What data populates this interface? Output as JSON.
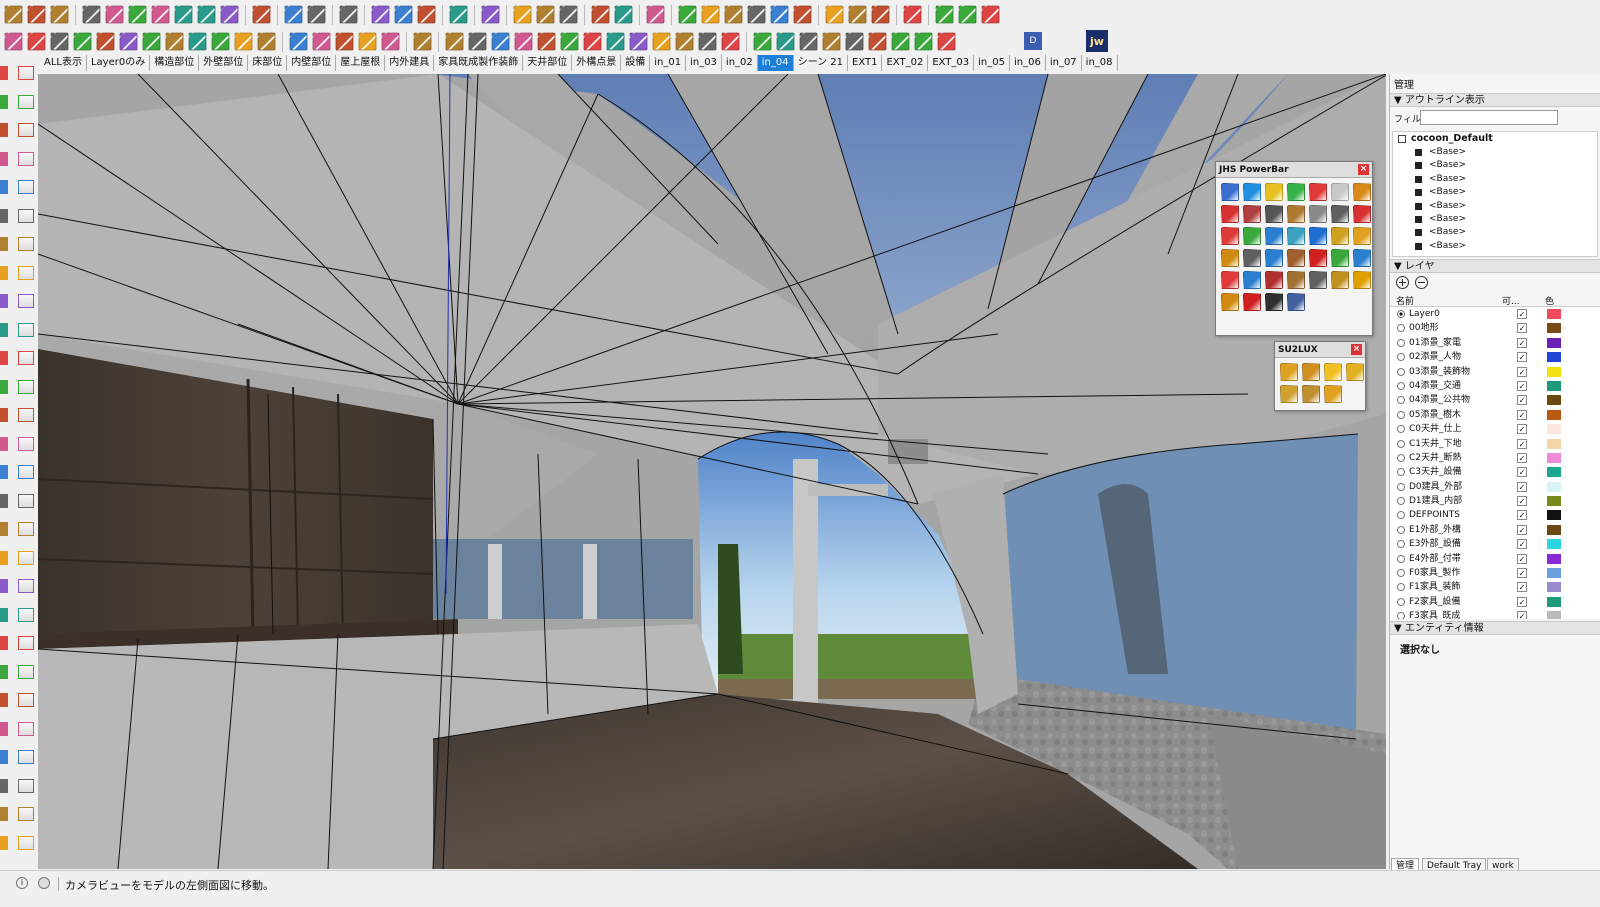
{
  "toolbar": {
    "row1_icons": [
      "box-icon",
      "cube-icon",
      "component-icon",
      "sep",
      "paint-bucket-icon",
      "push-pull-icon",
      "rotate-icon",
      "scale-icon",
      "offset-icon",
      "follow-me-icon",
      "intersect-icon",
      "sep",
      "section-icon",
      "sep",
      "dimension-icon",
      "clock-icon",
      "sep",
      "zoom-window-icon",
      "sep",
      "shield-icon",
      "sandbox-icon",
      "flip-icon",
      "sep",
      "purple-cone-icon",
      "sep",
      "leaf-icon",
      "sep",
      "plant-a-icon",
      "plant-b-icon",
      "plant-c-icon",
      "sep",
      "book-icon",
      "book-red-icon",
      "sep",
      "stairs-icon",
      "sep",
      "sphere-icon",
      "sphere2-icon",
      "sphere3-icon",
      "sphere4-icon",
      "sphere5-icon",
      "list-icon",
      "sep",
      "north-icon",
      "knife-icon",
      "target-icon",
      "sep",
      "record-icon",
      "sep",
      "orbit-icon",
      "render-a-icon",
      "render-b-icon"
    ],
    "row2_icons": [
      "wave-icon",
      "freehand-icon",
      "zigzag-icon",
      "bracket-icon",
      "arc-icon",
      "rect-icon",
      "circle-icon",
      "arc2-icon",
      "spiral-icon",
      "curve-icon",
      "curve2-icon",
      "curve3-icon",
      "sep",
      "tool-a-icon",
      "tool-b-icon",
      "wrench-icon",
      "ring-icon",
      "shape-icon",
      "sep",
      "gear-shade-icon",
      "sep",
      "edit-a-icon",
      "edit-b-icon",
      "edit-c-icon",
      "edit-d-icon",
      "edit-e-icon",
      "edit-f-icon",
      "edit-g-icon",
      "edit-h-icon",
      "edit-i-icon",
      "edit-j-icon",
      "edit-k-icon",
      "edit-l-icon",
      "help-icon",
      "sep",
      "pin-icon",
      "curve-tool-icon",
      "curve-tool2-icon",
      "target2-icon",
      "target3-icon",
      "curve-tool3-icon",
      "curve-tool4-icon",
      "play-icon",
      "step-icon"
    ],
    "d_button": "D",
    "jw_button": "jw"
  },
  "scene_tabs": {
    "items": [
      "ALL表示",
      "Layer0のみ",
      "構造部位",
      "外壁部位",
      "床部位",
      "内壁部位",
      "屋上屋根",
      "内外建具",
      "家具既成製作装飾",
      "天井部位",
      "外構点景",
      "設備",
      "in_01",
      "in_03",
      "in_02",
      "in_04",
      "シーン 21",
      "EXT1",
      "EXT_02",
      "EXT_03",
      "in_05",
      "in_06",
      "in_07",
      "in_08"
    ],
    "active_index": 15
  },
  "jhs_powerbar": {
    "title": "JHS PowerBar",
    "close": "×",
    "icon_colors": [
      "#3a6fcf",
      "#1f8fe0",
      "#e5c020",
      "#36b24a",
      "#e03a3a",
      "#c8c8c8",
      "#d98a1a",
      "#d63030",
      "#b04040",
      "#555555",
      "#b07830",
      "#8a8a8a",
      "#606060",
      "#d63030",
      "#e03a3a",
      "#3aa83a",
      "#2a7fd0",
      "#3aa0c0",
      "#1e6fd0",
      "#d0a020",
      "#e0a020",
      "#d08a10",
      "#606060",
      "#2a7fd0",
      "#a06030",
      "#d02020",
      "#3aa83a",
      "#2a7fd0",
      "#e03a3a",
      "#2a7fd0",
      "#b03030",
      "#a07030",
      "#606060",
      "#c09020",
      "#e0a000",
      "#d08a10",
      "#d02020",
      "#303030",
      "#4060a0"
    ]
  },
  "su2lux": {
    "title": "SU2LUX",
    "close": "×",
    "icon_colors": [
      "#e0a020",
      "#d09020",
      "#f0c020",
      "#e0b020",
      "#d0a030",
      "#c09030",
      "#e0a020"
    ]
  },
  "tray": {
    "title": "管理",
    "outline": {
      "header": "アウトライン表示",
      "filter_label": "フィル",
      "filter_value": "",
      "root": "cocoon_Default",
      "children": [
        "<Base>",
        "<Base>",
        "<Base>",
        "<Base>",
        "<Base>",
        "<Base>",
        "<Base>",
        "<Base>"
      ]
    },
    "layers": {
      "header": "レイヤ",
      "add_label": "+",
      "remove_label": "−",
      "col_name": "名前",
      "col_visible": "可...",
      "col_color": "色",
      "items": [
        {
          "name": "Layer0",
          "active": true,
          "color": "#f04b5a"
        },
        {
          "name": "00地形",
          "active": false,
          "color": "#7a4b12"
        },
        {
          "name": "01添景_家電",
          "active": false,
          "color": "#6b1fb5"
        },
        {
          "name": "02添景_人物",
          "active": false,
          "color": "#2046d8"
        },
        {
          "name": "03添景_装飾物",
          "active": false,
          "color": "#f2e010"
        },
        {
          "name": "04添景_交通",
          "active": false,
          "color": "#1c9b7c"
        },
        {
          "name": "04添景_公共物",
          "active": false,
          "color": "#6b4a12"
        },
        {
          "name": "05添景_樹木",
          "active": false,
          "color": "#b85a12"
        },
        {
          "name": "C0天井_仕上",
          "active": false,
          "color": "#fbe7e0"
        },
        {
          "name": "C1天井_下地",
          "active": false,
          "color": "#f5d6a8"
        },
        {
          "name": "C2天井_断熱",
          "active": false,
          "color": "#f08ad8"
        },
        {
          "name": "C3天井_設備",
          "active": false,
          "color": "#16a890"
        },
        {
          "name": "D0建具_外部",
          "active": false,
          "color": "#d8f4f6"
        },
        {
          "name": "D1建具_内部",
          "active": false,
          "color": "#7a8a1a"
        },
        {
          "name": "DEFPOINTS",
          "active": false,
          "color": "#111111"
        },
        {
          "name": "E1外部_外構",
          "active": false,
          "color": "#6b4a12"
        },
        {
          "name": "E3外部_設備",
          "active": false,
          "color": "#2ed6e0"
        },
        {
          "name": "E4外部_付帯",
          "active": false,
          "color": "#8a2ad6"
        },
        {
          "name": "F0家具_製作",
          "active": false,
          "color": "#6aa0e0"
        },
        {
          "name": "F1家具_装飾",
          "active": false,
          "color": "#9a8ad0"
        },
        {
          "name": "F2家具_設備",
          "active": false,
          "color": "#1c9b7c"
        },
        {
          "name": "F3家具_既成",
          "active": false,
          "color": "#bbbbbb"
        }
      ]
    },
    "entity": {
      "header": "エンティティ情報",
      "value": "選択なし"
    },
    "tabs": [
      "管理",
      "Default Tray",
      "work"
    ]
  },
  "statusbar": {
    "message": "カメラビューをモデルの左側面図に移動。"
  }
}
